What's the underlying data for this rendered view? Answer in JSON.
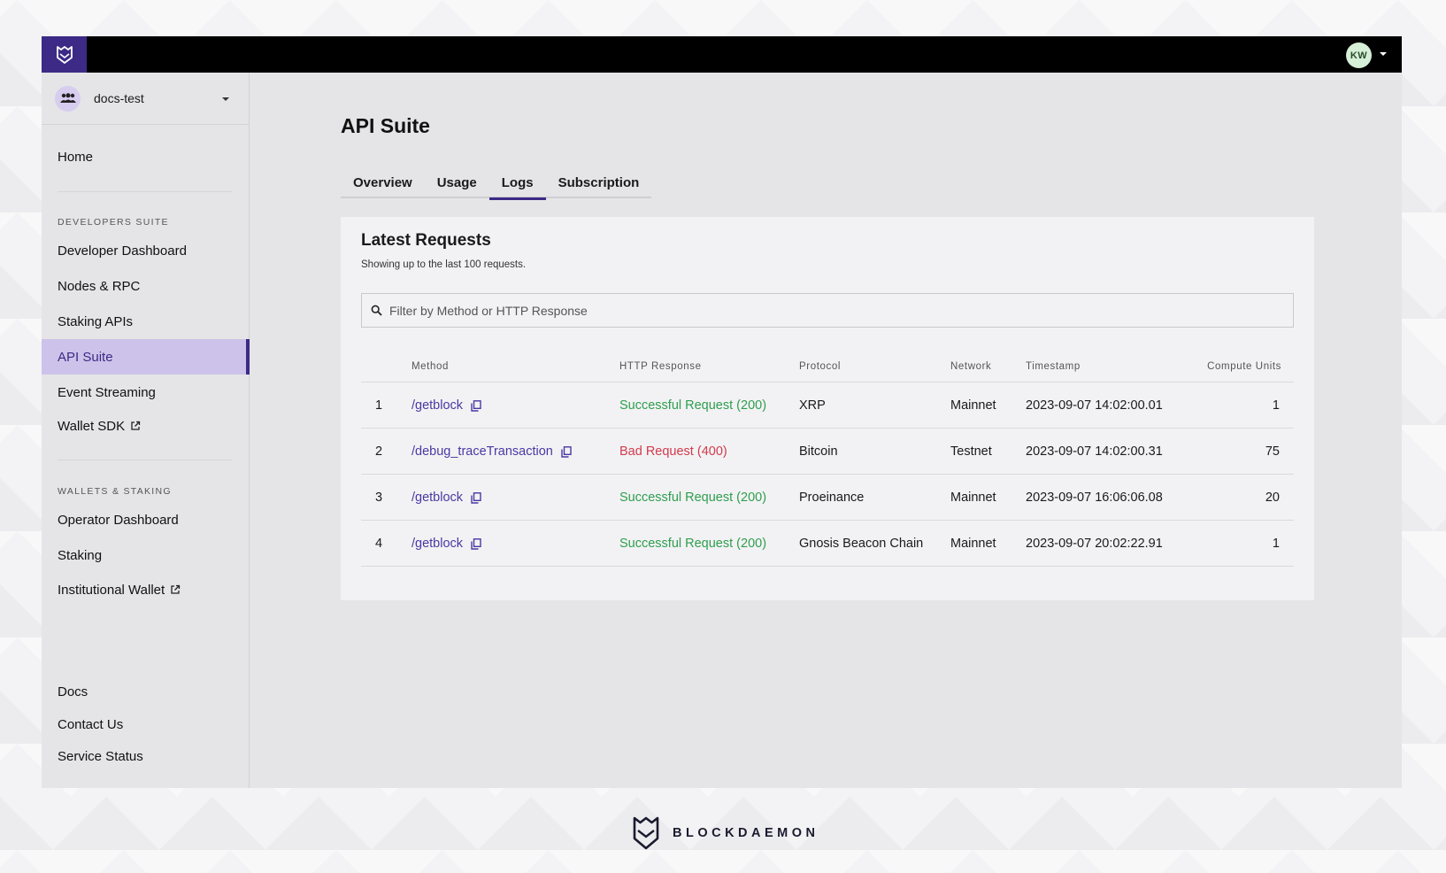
{
  "header": {
    "avatar_initials": "KW"
  },
  "org": {
    "name": "docs-test"
  },
  "sidebar": {
    "home": "Home",
    "section_dev": "DEVELOPERS SUITE",
    "dev_items": [
      "Developer Dashboard",
      "Nodes & RPC",
      "Staking APIs",
      "API Suite",
      "Event Streaming",
      "Wallet SDK"
    ],
    "section_wallets": "WALLETS & STAKING",
    "wallet_items": [
      "Operator Dashboard",
      "Staking",
      "Institutional Wallet"
    ],
    "footer_items": [
      "Docs",
      "Contact Us",
      "Service Status"
    ],
    "active": "API Suite"
  },
  "main": {
    "title": "API Suite",
    "tabs": [
      "Overview",
      "Usage",
      "Logs",
      "Subscription"
    ],
    "active_tab": "Logs"
  },
  "card": {
    "title": "Latest Requests",
    "subtitle": "Showing up to the last 100 requests.",
    "filter_placeholder": "Filter by Method or HTTP Response"
  },
  "table": {
    "headers": [
      "Method",
      "HTTP Response",
      "Protocol",
      "Network",
      "Timestamp",
      "Compute Units"
    ],
    "rows": [
      {
        "index": "1",
        "method": "/getblock",
        "response": "Successful Request (200)",
        "status": "ok",
        "protocol": "XRP",
        "network": "Mainnet",
        "timestamp": "2023-09-07 14:02:00.01",
        "units": "1"
      },
      {
        "index": "2",
        "method": "/debug_traceTransaction",
        "response": "Bad Request (400)",
        "status": "bad",
        "protocol": "Bitcoin",
        "network": "Testnet",
        "timestamp": "2023-09-07 14:02:00.31",
        "units": "75"
      },
      {
        "index": "3",
        "method": "/getblock",
        "response": "Successful Request (200)",
        "status": "ok",
        "protocol": "Proeinance",
        "network": "Mainnet",
        "timestamp": "2023-09-07 16:06:06.08",
        "units": "20"
      },
      {
        "index": "4",
        "method": "/getblock",
        "response": "Successful Request (200)",
        "status": "ok",
        "protocol": "Gnosis Beacon Chain",
        "network": "Mainnet",
        "timestamp": "2023-09-07 20:02:22.91",
        "units": "1"
      }
    ]
  },
  "brand": {
    "name": "BLOCKDAEMON"
  },
  "colors": {
    "accent": "#3c2a86",
    "active_bg": "#cdc3ea",
    "success": "#2f9e4f",
    "error": "#d23a4c"
  }
}
